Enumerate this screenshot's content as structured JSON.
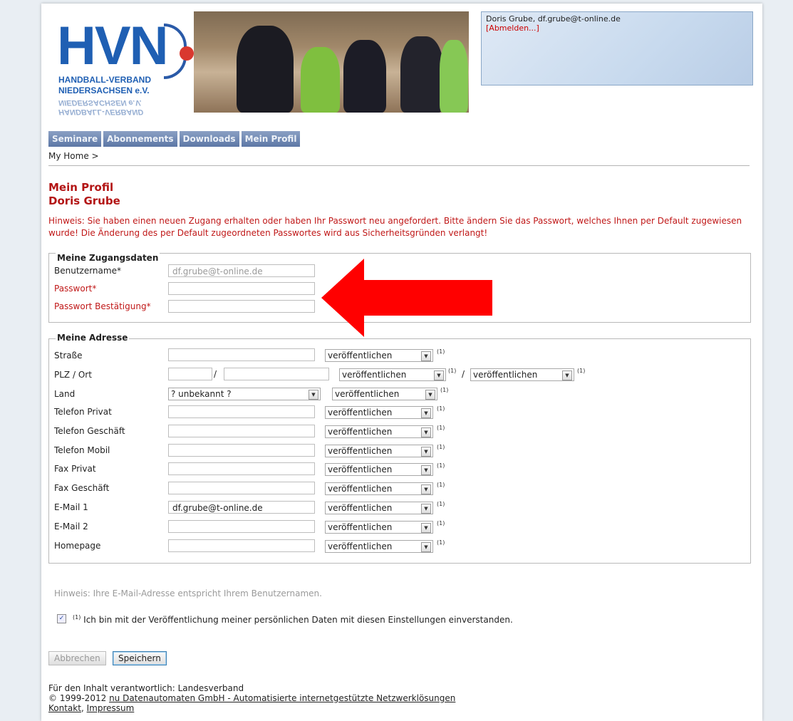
{
  "logo": {
    "main": "HVN",
    "line1": "HANDBALL-VERBAND",
    "line2": "NIEDERSACHSEN e.V.",
    "mirror1": "NIEDERSACHSEN e.V.",
    "mirror2": "HANDBALL-VERBAND"
  },
  "user": {
    "info": "Doris Grube, df.grube@t-online.de",
    "logout": "[Abmelden...]"
  },
  "nav": {
    "tabs": [
      "Seminare",
      "Abonnements",
      "Downloads",
      "Mein Profil"
    ]
  },
  "breadcrumb": "My Home >",
  "page": {
    "title": "Mein Profil",
    "name": "Doris Grube",
    "warning": "Hinweis: Sie haben einen neuen Zugang erhalten oder haben Ihr Passwort neu angefordert. Bitte ändern Sie das Passwort, welches Ihnen per Default zugewiesen wurde! Die Änderung des per Default zugeordneten Passwortes wird aus Sicherheitsgründen verlangt!"
  },
  "access": {
    "legend": "Meine Zugangsdaten",
    "username_label": "Benutzername*",
    "username_value": "df.grube@t-online.de",
    "password_label": "Passwort*",
    "password_confirm_label": "Passwort Bestätigung*"
  },
  "address": {
    "legend": "Meine Adresse",
    "street": "Straße",
    "plz_ort": "PLZ / Ort",
    "country": "Land",
    "country_value": "? unbekannt ?",
    "phone_private": "Telefon Privat",
    "phone_business": "Telefon Geschäft",
    "phone_mobile": "Telefon Mobil",
    "fax_private": "Fax Privat",
    "fax_business": "Fax Geschäft",
    "email1": "E-Mail 1",
    "email1_value": "df.grube@t-online.de",
    "email2": "E-Mail 2",
    "homepage": "Homepage",
    "publish": "veröffentlichen",
    "footnote": "(1)",
    "slash": "/"
  },
  "hint": "Hinweis: Ihre E-Mail-Adresse entspricht Ihrem Benutzernamen.",
  "consent": {
    "sup": "(1)",
    "text": "Ich bin mit der Veröffentlichung meiner persönlichen Daten mit diesen Einstellungen einverstanden.",
    "checked": "✓"
  },
  "buttons": {
    "cancel": "Abbrechen",
    "save": "Speichern"
  },
  "footer": {
    "line1": "Für den Inhalt verantwortlich: Landesverband",
    "copyright": "© 1999-2012",
    "company_link": "nu Datenautomaten GmbH - Automatisierte internetgestützte Netzwerklösungen",
    "contact_link": "Kontakt",
    "comma": ",",
    "imprint_link": "Impressum"
  },
  "colors": {
    "accent_red": "#b31515",
    "nav_blue": "#5d77a6",
    "annotation_arrow": "#ff0000"
  }
}
